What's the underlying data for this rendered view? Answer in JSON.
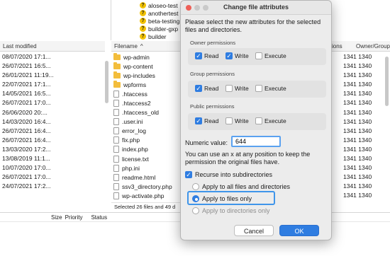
{
  "tree": {
    "items": [
      "aloseo-test",
      "anothertest",
      "beta-testing",
      "builder-gxp",
      "builder"
    ]
  },
  "local_headers": {
    "last_modified": "Last modified"
  },
  "local_dates": [
    "08/07/2020 17:1...",
    "26/07/2021 16:5...",
    "26/01/2021 11:19...",
    "22/07/2021 17:1...",
    "14/05/2021 16:5...",
    "26/07/2021 17:0...",
    "26/06/2020 20:...",
    "14/03/2020 16:4...",
    "26/07/2021 16:4...",
    "26/07/2021 16:4...",
    "13/03/2020 17:2...",
    "13/08/2019 11:1...",
    "10/07/2020 17:0...",
    "26/07/2021 17:0...",
    "24/07/2021 17:2..."
  ],
  "remote_headers": {
    "filename": "Filename",
    "perm": "ions",
    "owner": "Owner/Group"
  },
  "remote_files": [
    {
      "name": "wp-admin",
      "type": "folder"
    },
    {
      "name": "wp-content",
      "type": "folder"
    },
    {
      "name": "wp-includes",
      "type": "folder"
    },
    {
      "name": "wpforms",
      "type": "folder"
    },
    {
      "name": ".htaccess",
      "type": "file"
    },
    {
      "name": ".htaccess2",
      "type": "file"
    },
    {
      "name": ".htaccess_old",
      "type": "file"
    },
    {
      "name": ".user.ini",
      "type": "file"
    },
    {
      "name": "error_log",
      "type": "file"
    },
    {
      "name": "fix.php",
      "type": "file"
    },
    {
      "name": "index.php",
      "type": "file"
    },
    {
      "name": "license.txt",
      "type": "file"
    },
    {
      "name": "php.ini",
      "type": "file"
    },
    {
      "name": "readme.html",
      "type": "file"
    },
    {
      "name": "ssv3_directory.php",
      "type": "file"
    },
    {
      "name": "wp-activate.php",
      "type": "file"
    }
  ],
  "owner_values": [
    "1341 1340",
    "1341 1340",
    "1341 1340",
    "1341 1340",
    "1341 1340",
    "1341 1340",
    "1341 1340",
    "1341 1340",
    "1341 1340",
    "1341 1340",
    "1341 1340",
    "1341 1340",
    "1341 1340",
    "1341 1340",
    "1341 1340",
    "1341 1340"
  ],
  "remote_status": "Selected 26 files and 49 d",
  "queue": {
    "size": "Size",
    "priority": "Priority",
    "status": "Status"
  },
  "dialog": {
    "title": "Change file attributes",
    "intro": "Please select the new attributes for the selected files and directories.",
    "owner_label": "Owner permissions",
    "group_label": "Group permissions",
    "public_label": "Public permissions",
    "read": "Read",
    "write": "Write",
    "execute": "Execute",
    "numeric_label": "Numeric value:",
    "numeric_value": "644",
    "help": "You can use an x at any position to keep the permission the original files have.",
    "recurse": "Recurse into subdirectories",
    "apply_all": "Apply to all files and directories",
    "apply_files": "Apply to files only",
    "apply_dirs": "Apply to directories only",
    "cancel": "Cancel",
    "ok": "OK"
  }
}
